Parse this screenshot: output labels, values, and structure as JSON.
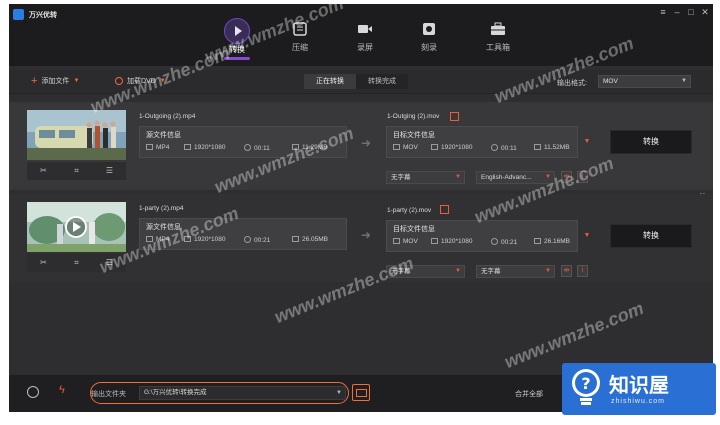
{
  "app": {
    "title": "万兴优转"
  },
  "nav": [
    {
      "label": "转换",
      "icon": "convert-icon",
      "active": true
    },
    {
      "label": "压缩",
      "icon": "compress-icon",
      "active": false
    },
    {
      "label": "录屏",
      "icon": "record-icon",
      "active": false
    },
    {
      "label": "刻录",
      "icon": "burn-icon",
      "active": false
    },
    {
      "label": "工具箱",
      "icon": "toolbox-icon",
      "active": false
    }
  ],
  "toolbar": {
    "add_file": "添加文件",
    "load_dvd": "加载DVD",
    "tab_converting": "正在转换",
    "tab_done": "转换完成",
    "format_label": "输出格式:",
    "format_value": "MOV"
  },
  "items": [
    {
      "source_name": "1-Outgoing (2).mp4",
      "source_title": "源文件信息",
      "source": {
        "format": "MP4",
        "resolution": "1920*1080",
        "duration": "00:11",
        "size": "11.29MB"
      },
      "target_name": "1-Outging (2).mov",
      "target_title": "目标文件信息",
      "target": {
        "format": "MOV",
        "resolution": "1920*1080",
        "duration": "00:11",
        "size": "11.52MB"
      },
      "subtitle": "无字幕",
      "audio": "English-Advanc...",
      "convert_label": "转换"
    },
    {
      "source_name": "1-party (2).mp4",
      "source_title": "源文件信息",
      "source": {
        "format": "MP4",
        "resolution": "1920*1080",
        "duration": "00:21",
        "size": "26.05MB"
      },
      "target_name": "1-party (2).mov",
      "target_title": "目标文件信息",
      "target": {
        "format": "MOV",
        "resolution": "1920*1080",
        "duration": "00:21",
        "size": "26.16MB"
      },
      "subtitle": "无字幕",
      "audio": "无字幕",
      "convert_label": "转换"
    }
  ],
  "bottom": {
    "output_label": "输出文件夹",
    "output_path": "G:\\万兴优转\\转换完成",
    "merge_label": "合并全部"
  },
  "watermark": {
    "text": "www.wmzhe.com"
  },
  "brand": {
    "name": "知识屋",
    "site": "zhishiwu.com"
  },
  "colors": {
    "accent": "#f26b3a",
    "nav_active": "#8a4ad3",
    "brand_blue": "#2a6fd4"
  }
}
